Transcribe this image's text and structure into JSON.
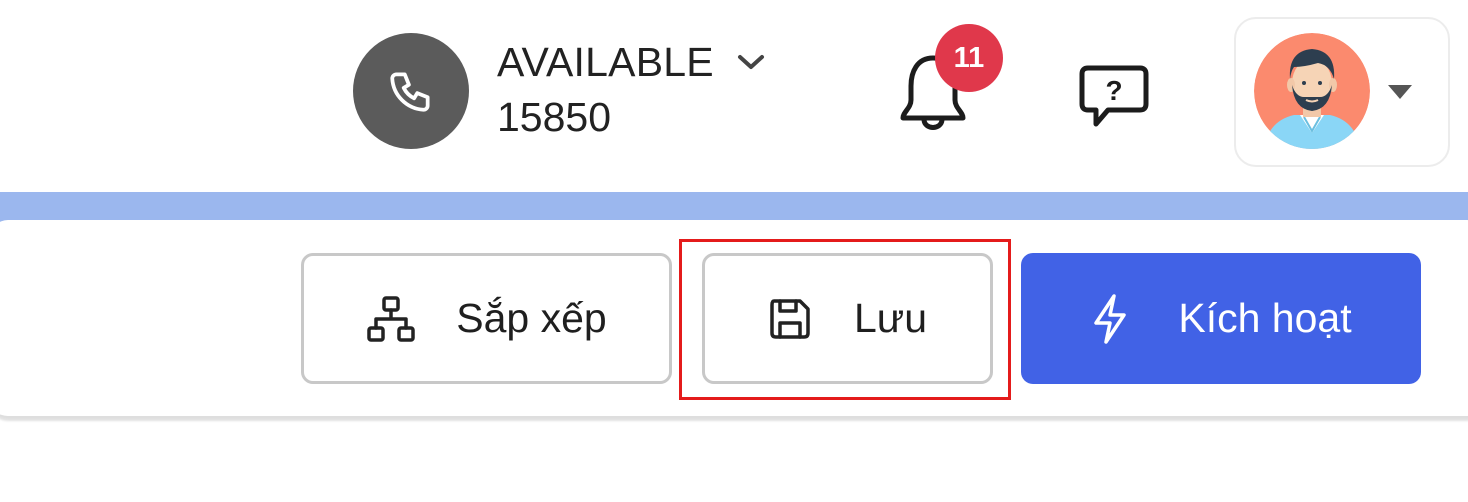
{
  "header": {
    "status_label": "AVAILABLE",
    "extension_number": "15850",
    "notification_count": "11",
    "icons": {
      "phone": "phone-icon",
      "status_dropdown": "chevron-down-icon",
      "notifications": "bell-icon",
      "help": "help-chat-icon",
      "profile_dropdown": "caret-down-icon"
    }
  },
  "toolbar": {
    "arrange_label": "Sắp xếp",
    "save_label": "Lưu",
    "activate_label": "Kích hoạt",
    "icons": {
      "arrange": "sitemap-icon",
      "save": "floppy-disk-icon",
      "activate": "lightning-bolt-icon"
    }
  },
  "colors": {
    "accent": "#4162e6",
    "band": "#9bb7ee",
    "badge": "#e0384b",
    "phone_button": "#5b5b5b",
    "highlight": "#e41b1b"
  }
}
